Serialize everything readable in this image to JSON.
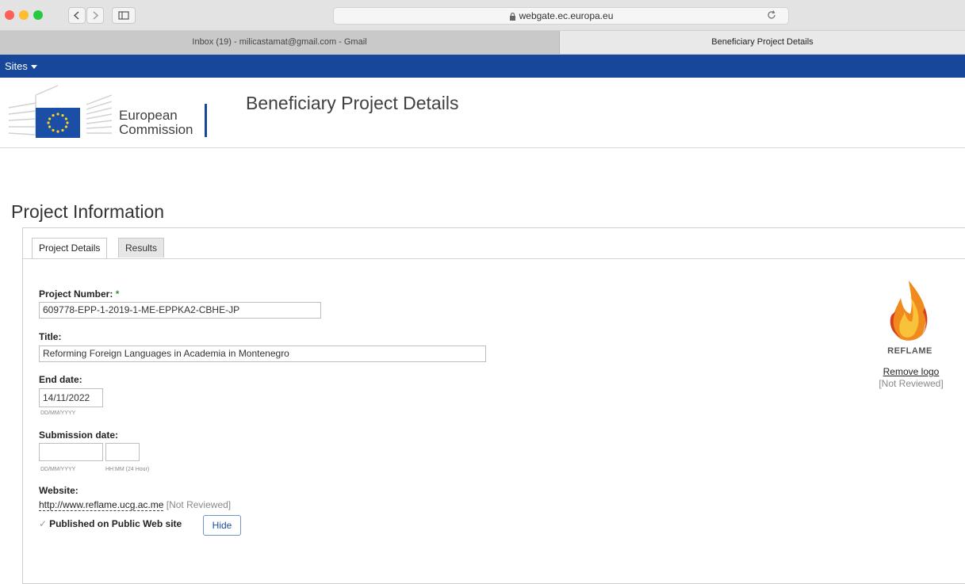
{
  "browser": {
    "url": "webgate.ec.europa.eu",
    "tabs": [
      {
        "label": "Inbox (19) - milicastamat@gmail.com - Gmail"
      },
      {
        "label": "Beneficiary Project Details"
      }
    ]
  },
  "site": {
    "sites_menu": "Sites",
    "logo_text_line1": "European",
    "logo_text_line2": "Commission",
    "page_title": "Beneficiary Project Details"
  },
  "section": {
    "title": "Project Information"
  },
  "tabs": [
    {
      "label": "Project Details",
      "active": true
    },
    {
      "label": "Results",
      "active": false
    }
  ],
  "form": {
    "project_number": {
      "label": "Project Number:",
      "required_mark": "*",
      "value": "609778-EPP-1-2019-1-ME-EPPKA2-CBHE-JP"
    },
    "title": {
      "label": "Title:",
      "value": "Reforming Foreign Languages in Academia in Montenegro"
    },
    "end_date": {
      "label": "End date:",
      "value": "14/11/2022",
      "hint": "DD/MM/YYYY"
    },
    "submission_date": {
      "label": "Submission date:",
      "date_value": "",
      "time_value": "",
      "date_hint": "DD/MM/YYYY",
      "time_hint": "HH:MM (24 Hour)"
    },
    "website": {
      "label": "Website:",
      "url": "http://www.reflame.ucg.ac.me",
      "status": "[Not Reviewed]"
    },
    "published": {
      "label": "Published on Public Web site",
      "checked": true,
      "hide_label": "Hide"
    }
  },
  "project_logo": {
    "logo_text": "REFLAME",
    "remove_label": "Remove logo",
    "status": "[Not Reviewed]"
  },
  "colors": {
    "ec_blue": "#16479a",
    "required_green": "#2e9a3c"
  }
}
